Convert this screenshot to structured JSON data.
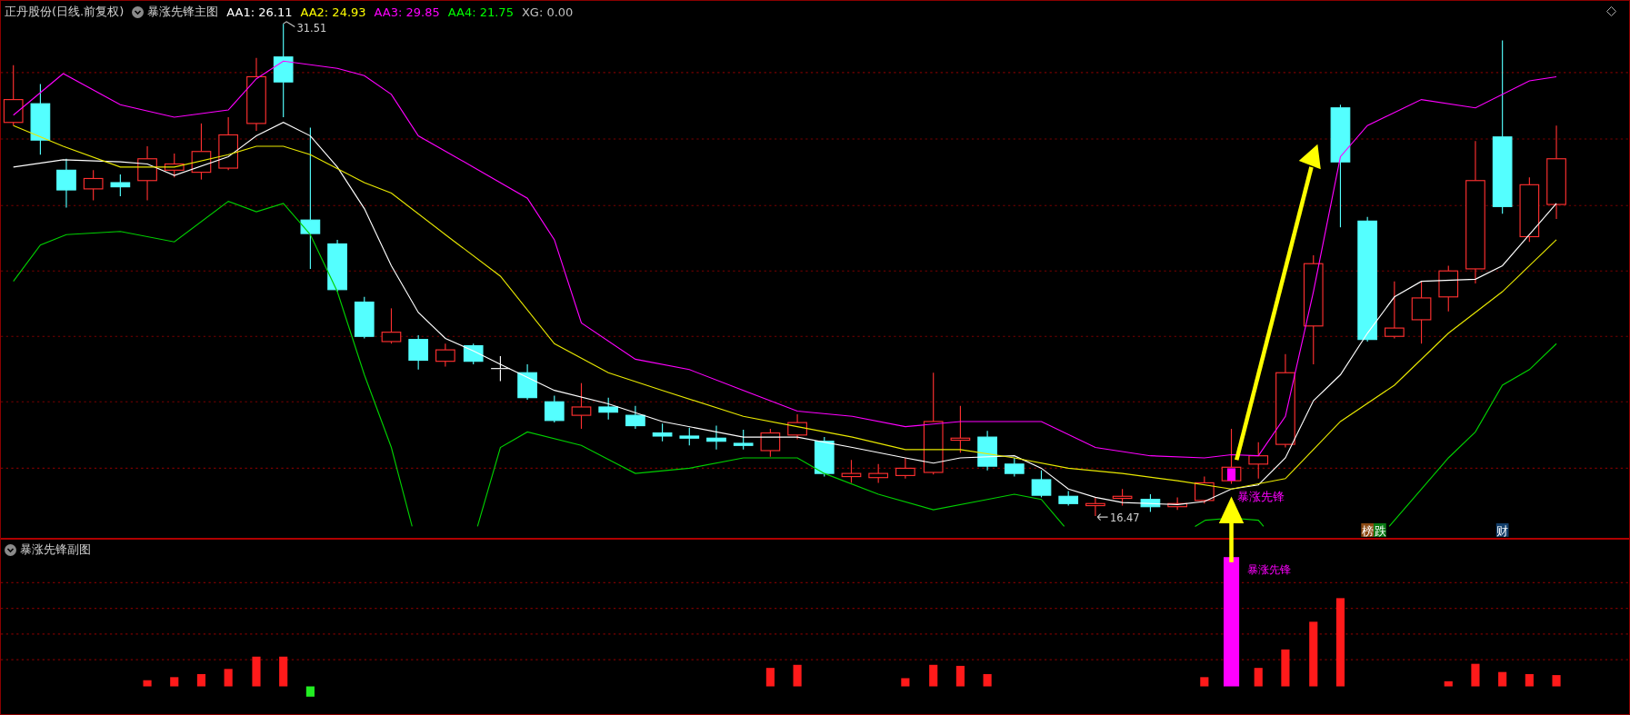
{
  "header": {
    "title": "正丹股份(日线.前复权)",
    "indicator": "暴涨先锋主图",
    "values": [
      {
        "label": "AA1: 26.11",
        "color": "#ffffff"
      },
      {
        "label": "AA2: 24.93",
        "color": "#ffff00"
      },
      {
        "label": "AA3: 29.85",
        "color": "#ff00ff"
      },
      {
        "label": "AA4: 21.75",
        "color": "#00ff00"
      },
      {
        "label": "XG: 0.00",
        "color": "#c0c0c0"
      }
    ]
  },
  "main_chart": {
    "high_label": "31.51",
    "low_label": "16.47",
    "signal_label": "暴涨先锋",
    "badges": [
      {
        "text": "榜",
        "color": "#8b4a14"
      },
      {
        "text": "跌",
        "color": "#0a7a14"
      },
      {
        "text": "财",
        "color": "#123e6a"
      }
    ]
  },
  "sub_chart": {
    "title": "暴涨先锋副图",
    "signal_label": "暴涨先锋"
  }
}
